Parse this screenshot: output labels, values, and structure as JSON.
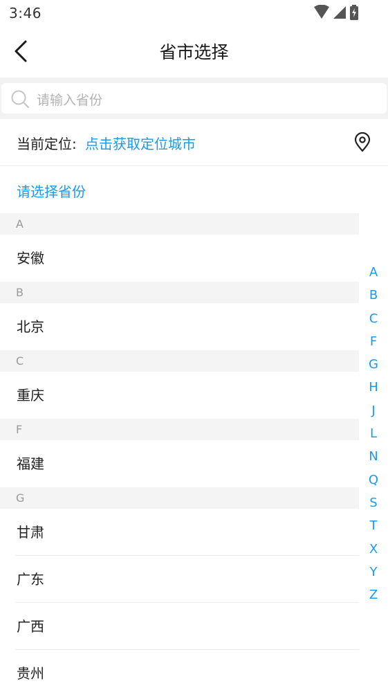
{
  "status_bar": {
    "time": "3:46"
  },
  "header": {
    "title": "省市选择"
  },
  "search": {
    "placeholder": "请输入省份"
  },
  "location": {
    "label": "当前定位:",
    "link": "点击获取定位城市"
  },
  "prompt": "请选择省份",
  "groups": [
    {
      "letter": "A",
      "items": [
        "安徽"
      ]
    },
    {
      "letter": "B",
      "items": [
        "北京"
      ]
    },
    {
      "letter": "C",
      "items": [
        "重庆"
      ]
    },
    {
      "letter": "F",
      "items": [
        "福建"
      ]
    },
    {
      "letter": "G",
      "items": [
        "甘肃",
        "广东",
        "广西",
        "贵州"
      ]
    }
  ],
  "index_letters": [
    "A",
    "B",
    "C",
    "F",
    "G",
    "H",
    "J",
    "L",
    "N",
    "Q",
    "S",
    "T",
    "X",
    "Y",
    "Z"
  ],
  "colors": {
    "accent": "#1a9be6",
    "section_bg": "#f4f4f4",
    "search_bg": "#f2f2f2"
  }
}
